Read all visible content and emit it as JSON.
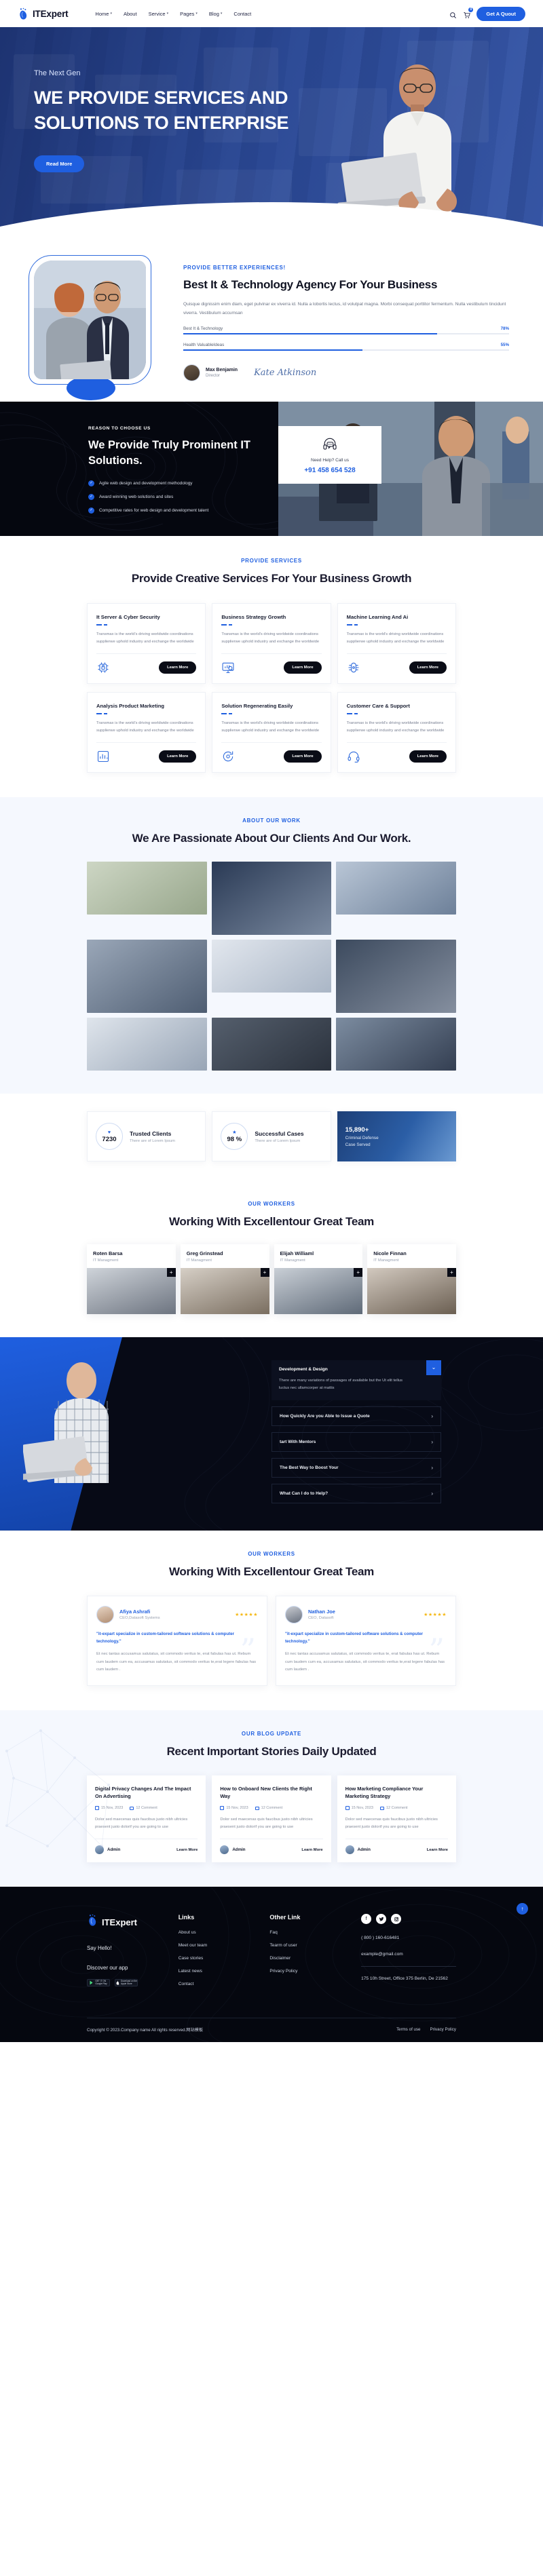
{
  "header": {
    "brand": "ITExpert",
    "nav": [
      {
        "label": "Home",
        "caret": true
      },
      {
        "label": "About",
        "caret": false
      },
      {
        "label": "Service",
        "caret": true
      },
      {
        "label": "Pages",
        "caret": true
      },
      {
        "label": "Blog",
        "caret": true
      },
      {
        "label": "Contact",
        "caret": false
      }
    ],
    "cart_count": "0",
    "quote_button": "Get A Quout"
  },
  "hero": {
    "kicker": "The Next Gen",
    "title": "WE PROVIDE SERVICES AND SOLUTIONS TO ENTERPRISE",
    "button": "Read More"
  },
  "about": {
    "eyebrow": "PROVIDE BETTER EXPERIENCES!",
    "title": "Best It & Technology Agency For Your Business",
    "paragraph": "Quisque dignissim enim diam, eget pulvinar ex viverra id. Nulla a lobortis lectus, id volutpat magna. Morbi consequat porttitor fermentum. Nulla vestibulum tincidunt viverra. Vestibulum accumsan",
    "skills": [
      {
        "label": "Best It & Technology",
        "percent": "78%",
        "value": 78
      },
      {
        "label": "Health ValuableIdeas",
        "percent": "55%",
        "value": 55
      }
    ],
    "author_name": "Max Benjamin",
    "author_role": "Director",
    "signature": "Kate Atkinson"
  },
  "reason": {
    "kicker": "REASON TO CHOOSE US",
    "title": "We Provide Truly Prominent IT Solutions.",
    "checks": [
      "Agile web design and development methodology",
      "Award winning web solutions and sites",
      "Competitive rates for web design and development talent"
    ],
    "call_label": "Need Help? Call us",
    "call_number": "+91 458 654 528"
  },
  "services": {
    "eyebrow": "PROVIDE SERVICES",
    "title": "Provide Creative Services For Your Business Growth",
    "card_text": "Transmax is the world's driving worldwide coordinations supplierwe uphold industry and exchange the worldwide",
    "learn_more": "Learn More",
    "cards": [
      {
        "title": "It Server & Cyber Security",
        "icon": "chip-lock-icon"
      },
      {
        "title": "Business Strategy Growth",
        "icon": "chart-search-icon"
      },
      {
        "title": "Machine Learning And Ai",
        "icon": "brain-circuit-icon"
      },
      {
        "title": "Analysis Product Marketing",
        "icon": "analytics-icon"
      },
      {
        "title": "Solution Regenerating Easily",
        "icon": "refresh-gear-icon"
      },
      {
        "title": "Customer Care & Support",
        "icon": "headset-support-icon"
      }
    ]
  },
  "work": {
    "eyebrow": "ABOUT OUR WORK",
    "title": "We Are Passionate About Our Clients And Our Work."
  },
  "stats": [
    {
      "number": "7230",
      "icon": "heart-icon",
      "name": "Trusted Clients",
      "sub": "There are of Lorem Ipsum"
    },
    {
      "number": "98 %",
      "icon": "star-icon",
      "name": "Successful Cases",
      "sub": "There are of Lorem Ipsum"
    }
  ],
  "stats_photo": {
    "number": "15,890+",
    "line1": "Criminal Defense",
    "line2": "Case Served"
  },
  "team": {
    "eyebrow": "OUR WORKERS",
    "title": "Working With Excellentour Great Team",
    "members": [
      {
        "name": "Roten Barsa",
        "role": "IT Managment"
      },
      {
        "name": "Greg Grinstead",
        "role": "IT Managment"
      },
      {
        "name": "Elijah Williaml",
        "role": "IT Managment"
      },
      {
        "name": "Nicole Finnan",
        "role": "IT Managment"
      }
    ]
  },
  "faq": {
    "open": {
      "title": "Development & Design",
      "body": "There are many variations of passages of available but the Ut elit tellus luctus nec ullamcorper at mattis"
    },
    "items": [
      "How Quickly Are you Able to Issue a Quote",
      "tart With Mentors",
      "The Best Way to Boost Your",
      "What Can I do to Help?"
    ]
  },
  "testimonials": {
    "eyebrow": "OUR WORKERS",
    "title": "Working With Excellentour Great Team",
    "cards": [
      {
        "name": "Afiya Ashrafi",
        "role": "CEO,Datasoft Systems",
        "stars": "★★★★★",
        "quote": "\"it-expart specialize in custom-tailored software solutions & computer technology.\"",
        "body": "Et nec tantas accusamus salutatus, sit commodo veritus te, erat fabulas has ut. Rebum cum laudem cum ea, accusamus salutatus, sit commodo veritus te,erat legere fabulas has cum laudem ."
      },
      {
        "name": "Nathan Joe",
        "role": "CEO, Datasoft",
        "stars": "★★★★★",
        "quote": "\"it-expart specialize in custom-tailored software solutions & computer technology.\"",
        "body": "Et nec tantas accusamus salutatus, sit commodo veritus te, erat fabulas has ut. Rebum cum laudem cum ea, accusamus salutatus, sit commodo veritus te,erat legere fabulas has cum laudem ."
      }
    ]
  },
  "blog": {
    "eyebrow": "OUR BLOG UPDATE",
    "title": "Recent Important Stories Daily Updated",
    "excerpt": "Dolor sed maecenas quis faucibus justo nibh ultricies praesent justo dolorif you are going to use",
    "author": "Admin",
    "learn_more": "Learn More",
    "posts": [
      {
        "title": "Digital Privacy Changes And The Impact On Advertising",
        "date": "15 Nov, 2023",
        "comments": "12 Comment"
      },
      {
        "title": "How to Onboard New Clients the Right Way",
        "date": "15 Nov, 2023",
        "comments": "12 Comment"
      },
      {
        "title": "How Marketing Compliance Your Marketing Strategy",
        "date": "15 Nov, 2023",
        "comments": "12 Comment"
      }
    ]
  },
  "footer": {
    "brand": "ITExpert",
    "say_hello": "Say Hello!",
    "discover": "Discover our app",
    "store_google_top": "GET IT ON",
    "store_google_bottom": "Google Play",
    "store_apple_top": "Download on the",
    "store_apple_bottom": "Apple Store",
    "links_heading": "Links",
    "links": [
      "About us",
      "Meet our team",
      "Case stories",
      "Latest news",
      "Contact"
    ],
    "other_heading": "Other Link",
    "other_links": [
      "Faq",
      "Tearm of user",
      "Disclaimer",
      "Privacy Policy"
    ],
    "phone": "( 800 ) 160-616481",
    "email": "example@gmail.com",
    "address": "175 10h Street, Office 375 Berlin, De 21562",
    "copyright": "Copyright © 2023.Company name All rights reserved.网站模板",
    "bottom_links": [
      "Terms of use",
      "Privacy Policy"
    ]
  },
  "colors": {
    "accent": "#1f5fe0",
    "dark": "#05070f",
    "star": "#f5b917"
  }
}
